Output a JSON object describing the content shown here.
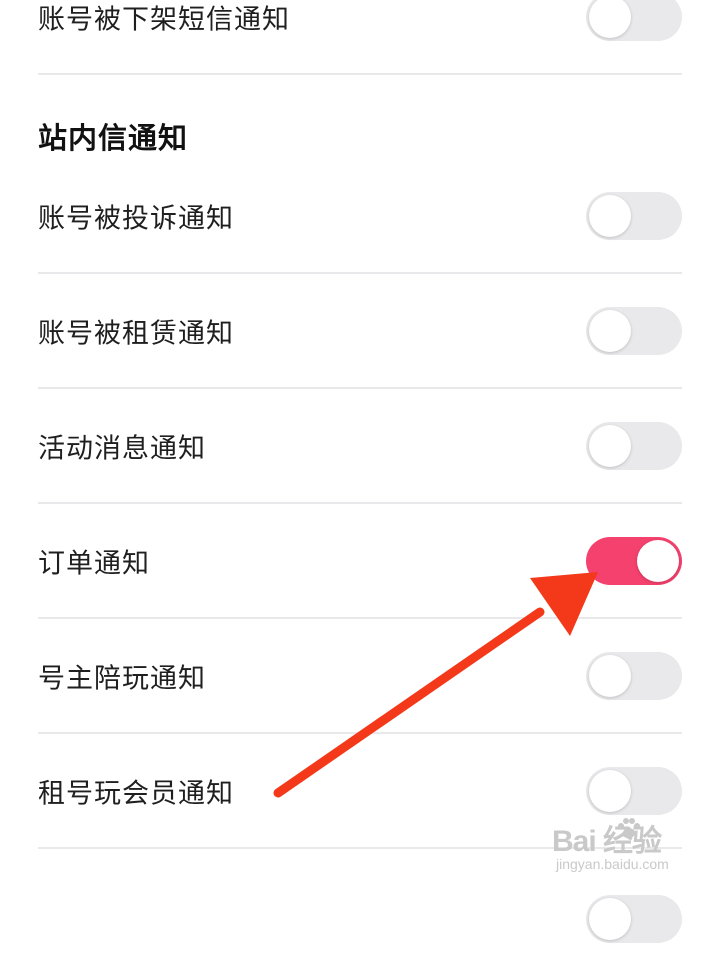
{
  "sms_section": {
    "items": [
      {
        "label": "账号被下架短信通知",
        "enabled": false
      }
    ]
  },
  "site_section": {
    "title": "站内信通知",
    "items": [
      {
        "label": "账号被投诉通知",
        "enabled": false
      },
      {
        "label": "账号被租赁通知",
        "enabled": false
      },
      {
        "label": "活动消息通知",
        "enabled": false
      },
      {
        "label": "订单通知",
        "enabled": true
      },
      {
        "label": "号主陪玩通知",
        "enabled": false
      },
      {
        "label": "租号玩会员通知",
        "enabled": false
      }
    ]
  },
  "colors": {
    "toggle_on": "#f4416e",
    "toggle_off": "#e9e9eb",
    "annotation_arrow": "#f4391a"
  },
  "watermark": {
    "main": "Bai  经验",
    "sub": "jingyan.baidu.com"
  }
}
